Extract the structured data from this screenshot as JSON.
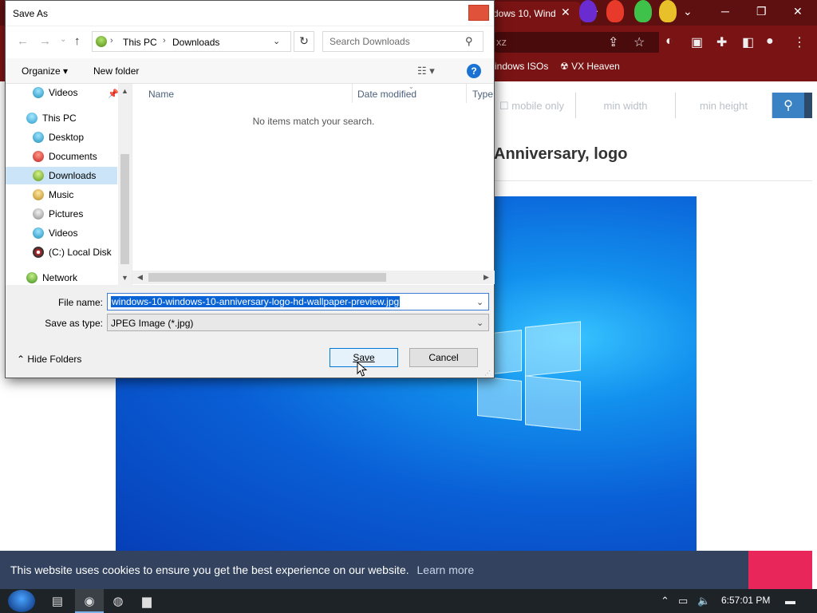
{
  "browser": {
    "tab_title": "dows 10, Wind",
    "omnibox_text": "xz",
    "bookmarks": [
      "indows ISOs",
      "VX Heaven"
    ],
    "site_filters": {
      "mobile_only": "mobile only",
      "min_width": "min width",
      "min_height": "min height"
    },
    "page_heading": "Anniversary, logo",
    "cookie_text": "This website uses cookies to ensure you get the best experience on our website.",
    "cookie_link": "Learn more"
  },
  "dialog": {
    "title": "Save As",
    "address": {
      "crumbs": [
        "This PC",
        "Downloads"
      ]
    },
    "search_placeholder": "Search Downloads",
    "commands": {
      "organize": "Organize ▾",
      "new_folder": "New folder"
    },
    "nav": [
      {
        "label": "Videos",
        "icon": "videos-icon",
        "pinned": true
      },
      {
        "label": "This PC",
        "icon": "this-pc-icon"
      },
      {
        "label": "Desktop",
        "icon": "desktop-icon"
      },
      {
        "label": "Documents",
        "icon": "documents-icon"
      },
      {
        "label": "Downloads",
        "icon": "downloads-icon",
        "selected": true
      },
      {
        "label": "Music",
        "icon": "music-icon"
      },
      {
        "label": "Pictures",
        "icon": "pictures-icon"
      },
      {
        "label": "Videos",
        "icon": "videos-icon"
      },
      {
        "label": "(C:) Local Disk",
        "icon": "local-disk-icon"
      },
      {
        "label": "Network",
        "icon": "network-icon"
      }
    ],
    "columns": [
      "Name",
      "Date modified",
      "Type"
    ],
    "empty_message": "No items match your search.",
    "file_name_label": "File name:",
    "file_name_value": "windows-10-windows-10-anniversary-logo-hd-wallpaper-preview.jpg",
    "save_type_label": "Save as type:",
    "save_type_value": "JPEG Image (*.jpg)",
    "hide_folders": "Hide Folders",
    "save_label": "Save",
    "cancel_label": "Cancel"
  },
  "taskbar": {
    "clock": "6:57:01 PM"
  },
  "colors": {
    "browser_frame": "#7a1414",
    "accent": "#0078d7",
    "selection": "#0a64d6",
    "cookie_bar": "#33435f"
  }
}
